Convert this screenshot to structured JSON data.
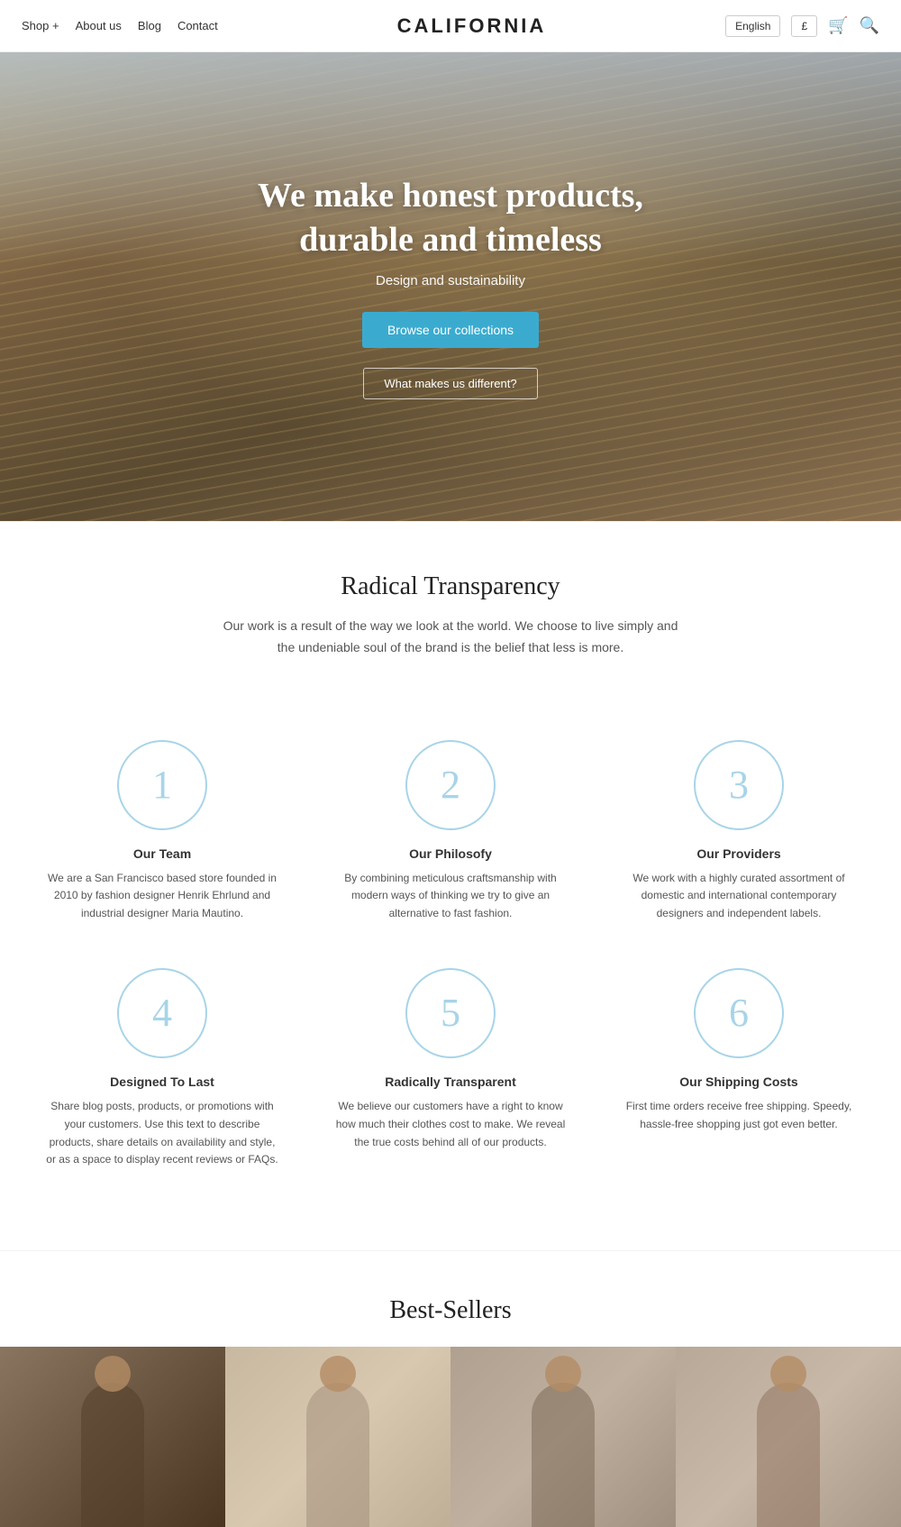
{
  "nav": {
    "logo": "CALIFORNIA",
    "links": [
      "Shop +",
      "About us",
      "Blog",
      "Contact"
    ],
    "language_label": "English",
    "currency_label": "£"
  },
  "hero": {
    "title_line1": "We make honest products,",
    "title_line2": "durable and timeless",
    "subtitle": "Design and sustainability",
    "cta_primary": "Browse our collections",
    "cta_secondary": "What makes us different?"
  },
  "transparency": {
    "heading": "Radical Transparency",
    "body": "Our work is a result of the way we look at the world. We choose to live simply and the undeniable soul of the brand is the belief that less is more."
  },
  "features": [
    {
      "number": "1",
      "title": "Our Team",
      "desc": "We are a San Francisco based store founded in 2010 by fashion designer Henrik Ehrlund and industrial designer Maria Mautino."
    },
    {
      "number": "2",
      "title": "Our Philosofy",
      "desc": "By combining meticulous craftsmanship with modern ways of thinking we try to give an alternative to fast fashion."
    },
    {
      "number": "3",
      "title": "Our Providers",
      "desc": "We work with a highly curated assortment of domestic and international contemporary designers and independent labels."
    },
    {
      "number": "4",
      "title": "Designed To Last",
      "desc": "Share blog posts, products, or promotions with your customers. Use this text to describe products, share details on availability and style, or as a space to display recent reviews or FAQs."
    },
    {
      "number": "5",
      "title": "Radically Transparent",
      "desc": "We believe our customers have a right to know how much their clothes cost to make. We reveal the true costs behind all of our products."
    },
    {
      "number": "6",
      "title": "Our Shipping Costs",
      "desc": "First time orders receive free shipping. Speedy, hassle-free shopping just got even better."
    }
  ],
  "best_sellers": {
    "heading": "Best-Sellers"
  }
}
